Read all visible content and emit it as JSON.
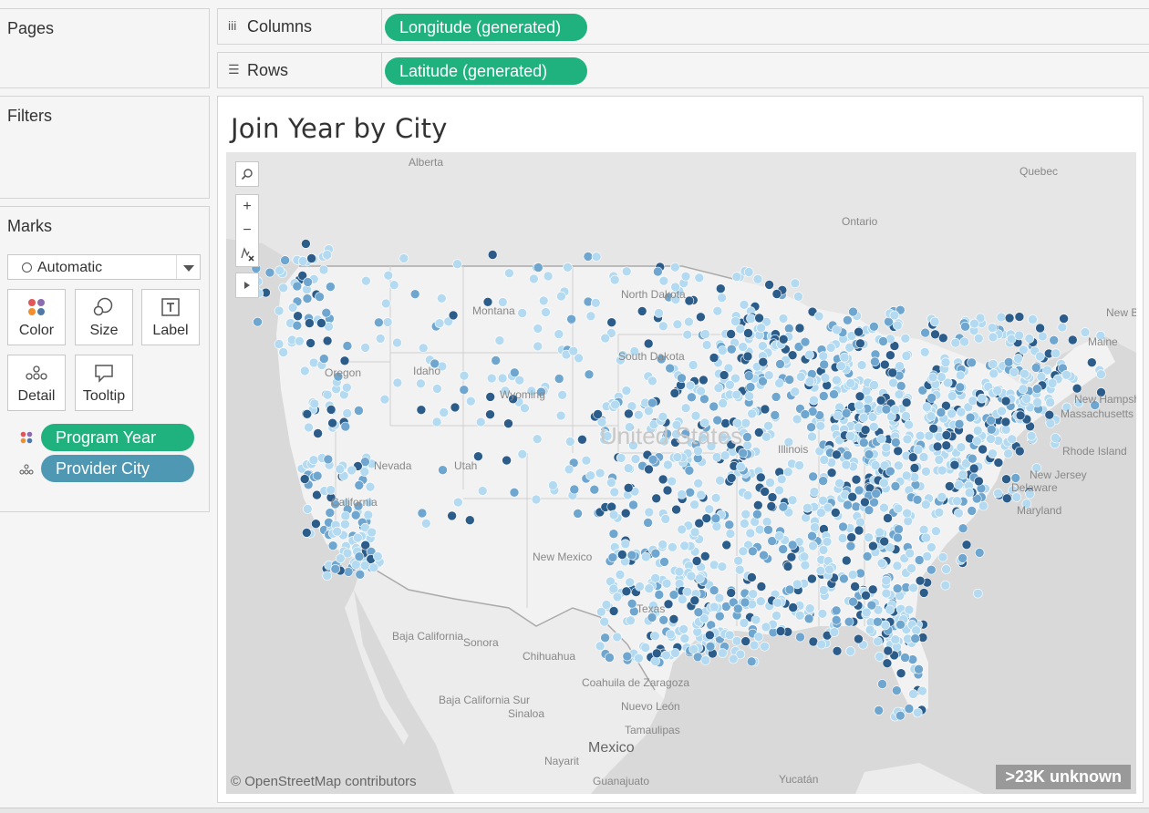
{
  "shelves": {
    "pages_title": "Pages",
    "filters_title": "Filters",
    "columns_label": "Columns",
    "columns_pill": "Longitude (generated)",
    "rows_label": "Rows",
    "rows_pill": "Latitude (generated)"
  },
  "marks": {
    "title": "Marks",
    "mark_type": "Automatic",
    "buttons": [
      "Color",
      "Size",
      "Label",
      "Detail",
      "Tooltip"
    ],
    "fields": [
      {
        "label": "Program Year",
        "icon": "color-dots-icon",
        "color": "#1fb27f"
      },
      {
        "label": "Provider City",
        "icon": "detail-dots-icon",
        "color": "#4e98b4"
      }
    ]
  },
  "viz": {
    "title": "Join Year by City",
    "attribution": "© OpenStreetMap contributors",
    "unknown_badge": ">23K unknown"
  },
  "map_labels": {
    "alberta": "Alberta",
    "quebec": "Quebec",
    "ontario": "Ontario",
    "montana": "Montana",
    "north_dakota": "North Dakota",
    "south_dakota": "South Dakota",
    "idaho": "Idaho",
    "oregon": "Oregon",
    "wyoming": "Wyoming",
    "nevada": "Nevada",
    "utah": "Utah",
    "california": "California",
    "new_mexico": "New Mexico",
    "texas": "Texas",
    "illinois": "Illinois",
    "united_states": "United States",
    "maine": "Maine",
    "new_hampshire": "New Hampshire",
    "massachusetts": "Massachusetts",
    "rhode_island": "Rhode Island",
    "new_jersey": "New Jersey",
    "delaware": "Delaware",
    "maryland": "Maryland",
    "new_brunswick": "New Brunswick",
    "baja_california": "Baja California",
    "sonora": "Sonora",
    "chihuahua": "Chihuahua",
    "coahuila": "Coahuila de Zaragoza",
    "baja_california_sur": "Baja California Sur",
    "sinaloa": "Sinaloa",
    "nuevo_leon": "Nuevo León",
    "tamaulipas": "Tamaulipas",
    "mexico": "Mexico",
    "nayarit": "Nayarit",
    "guanajuato": "Guanajuato",
    "yucatan": "Yucatán"
  },
  "colors": {
    "pill_green": "#1fb27f",
    "pill_blue": "#4e98b4",
    "point_light": "#b3daf0",
    "point_mid": "#6fa6cf",
    "point_dark": "#2b5c8a",
    "land": "#e8e8e8",
    "water": "#d7d7d7"
  }
}
